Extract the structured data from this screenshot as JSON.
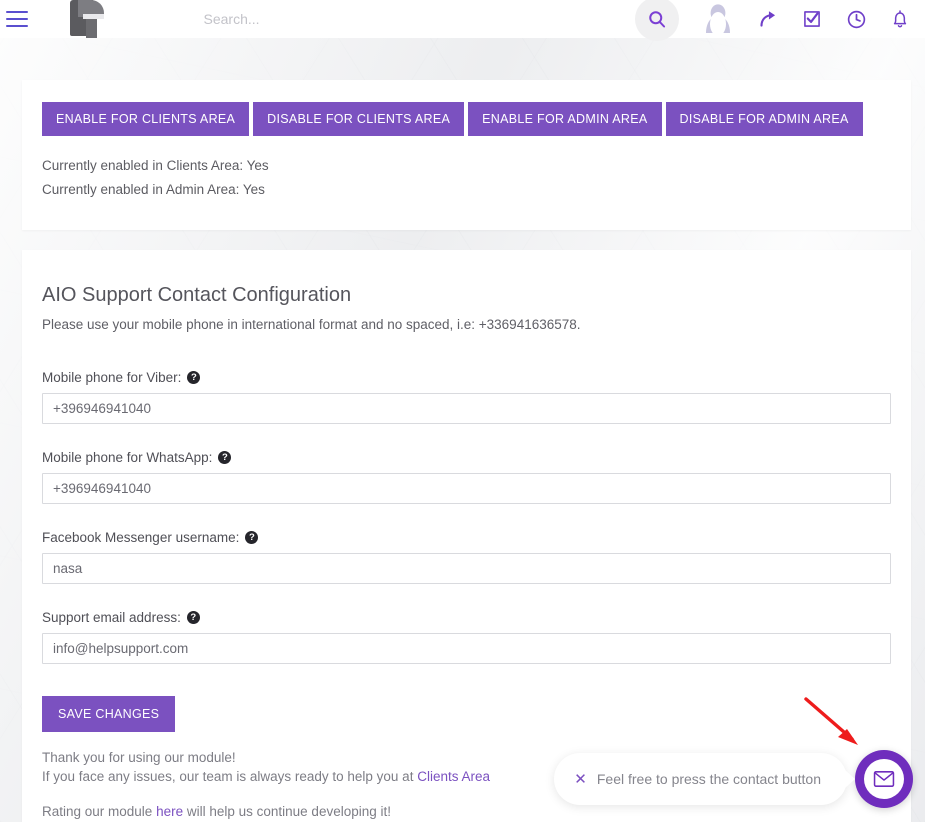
{
  "topbar": {
    "menu_icon": "hamburger-icon",
    "logo_alt": "site-logo",
    "search_placeholder": "Search...",
    "search_value": "",
    "icons": [
      {
        "name": "search-icon",
        "label": "Search"
      },
      {
        "name": "user-avatar-icon",
        "label": "Account"
      },
      {
        "name": "share-arrow-icon",
        "label": "Share"
      },
      {
        "name": "checkbox-tasks-icon",
        "label": "Tasks"
      },
      {
        "name": "clock-history-icon",
        "label": "History"
      },
      {
        "name": "bell-notification-icon",
        "label": "Notifications"
      }
    ]
  },
  "toggle_card": {
    "buttons": [
      {
        "label": "ENABLE FOR CLIENTS AREA"
      },
      {
        "label": "DISABLE FOR CLIENTS AREA"
      },
      {
        "label": "ENABLE FOR ADMIN AREA"
      },
      {
        "label": "DISABLE FOR ADMIN AREA"
      }
    ],
    "status_clients": "Currently enabled in Clients Area: Yes",
    "status_admin": "Currently enabled in Admin Area: Yes"
  },
  "config_card": {
    "title": "AIO Support Contact Configuration",
    "subtitle": "Please use your mobile phone in international format and no spaced, i.e: +336941636578.",
    "fields": [
      {
        "name": "viber-phone",
        "label": "Mobile phone for Viber:",
        "help": "?",
        "value": "+396946941040",
        "placeholder": "+396946941040"
      },
      {
        "name": "whatsapp-phone",
        "label": "Mobile phone for WhatsApp:",
        "help": "?",
        "value": "+396946941040",
        "placeholder": "+396946941040"
      },
      {
        "name": "facebook-messenger-username",
        "label": "Facebook Messenger username:",
        "help": "?",
        "value": "nasa",
        "placeholder": "nasa"
      },
      {
        "name": "support-email",
        "label": "Support email address:",
        "help": "?",
        "value": "info@helpsupport.com",
        "placeholder": "info@helpsupport.com"
      }
    ],
    "save_label": "SAVE CHANGES",
    "footer": {
      "line1": "Thank you for using our module!",
      "line2_pre": "If you face any issues, our team is always ready to help you at ",
      "line2_link": "Clients Area",
      "line3_pre": "Rating our module ",
      "line3_link": "here",
      "line3_post": " will help us continue developing it!"
    }
  },
  "contact_widget": {
    "close_label": "✕",
    "message": "Feel free to press the contact button",
    "fab_icon": "envelope-icon"
  },
  "annotation": {
    "arrow": "red-arrow-pointing-to-contact-button"
  },
  "colors": {
    "primary_purple": "#7b51c0",
    "fab_purple": "#6f2dbd",
    "page_bg": "#eff0f2",
    "card_bg": "#ffffff",
    "arrow_red": "#ee1c1c"
  }
}
